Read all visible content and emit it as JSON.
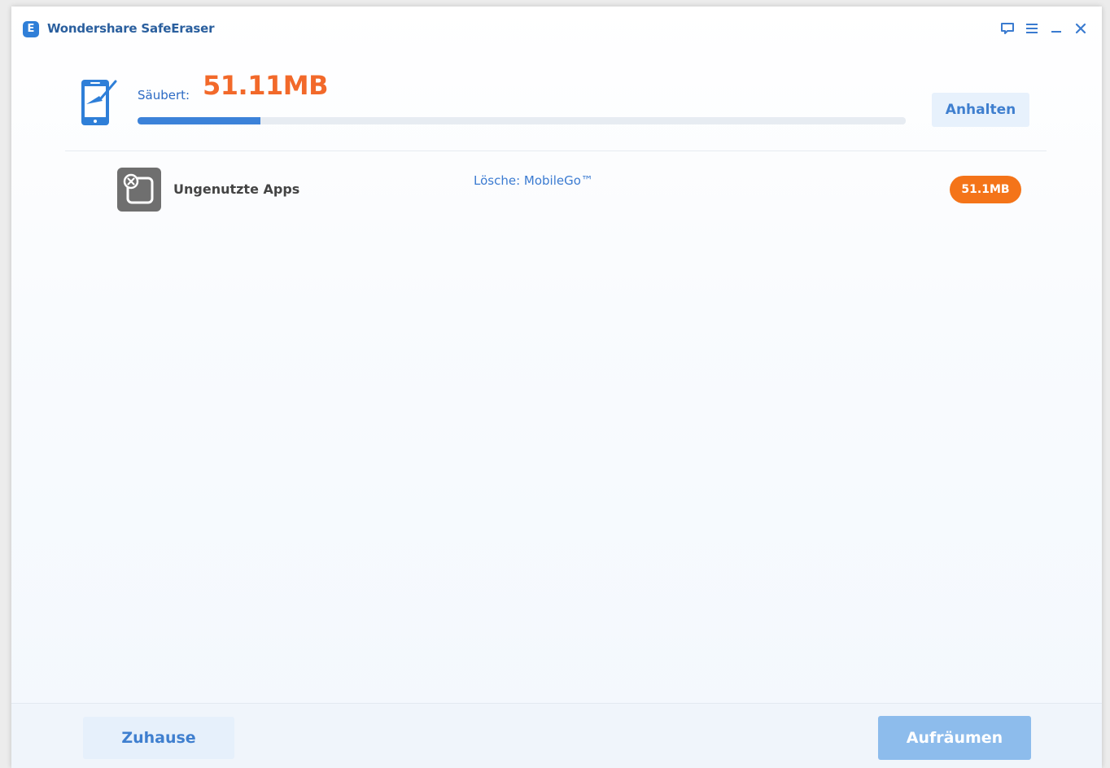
{
  "app": {
    "title": "Wondershare SafeEraser",
    "logo_letter": "E"
  },
  "window_controls": [
    {
      "name": "feedback-icon"
    },
    {
      "name": "menu-icon"
    },
    {
      "name": "minimize-icon"
    },
    {
      "name": "close-icon"
    }
  ],
  "header": {
    "icon": "phone-cleaning-icon",
    "cleaned_label": "Säubert:",
    "cleaned_value": "51.11MB",
    "progress_fraction": 0.16,
    "pause_label": "Anhalten"
  },
  "items": [
    {
      "icon": "unused-app-icon",
      "name": "Ungenutzte Apps",
      "status": "Lösche: MobileGo™",
      "size": "51.1MB"
    }
  ],
  "footer": {
    "home_label": "Zuhause",
    "clean_label": "Aufräumen"
  },
  "colors": {
    "accent": "#3c82d9",
    "highlight": "#f2692a",
    "badge": "#f47419"
  }
}
